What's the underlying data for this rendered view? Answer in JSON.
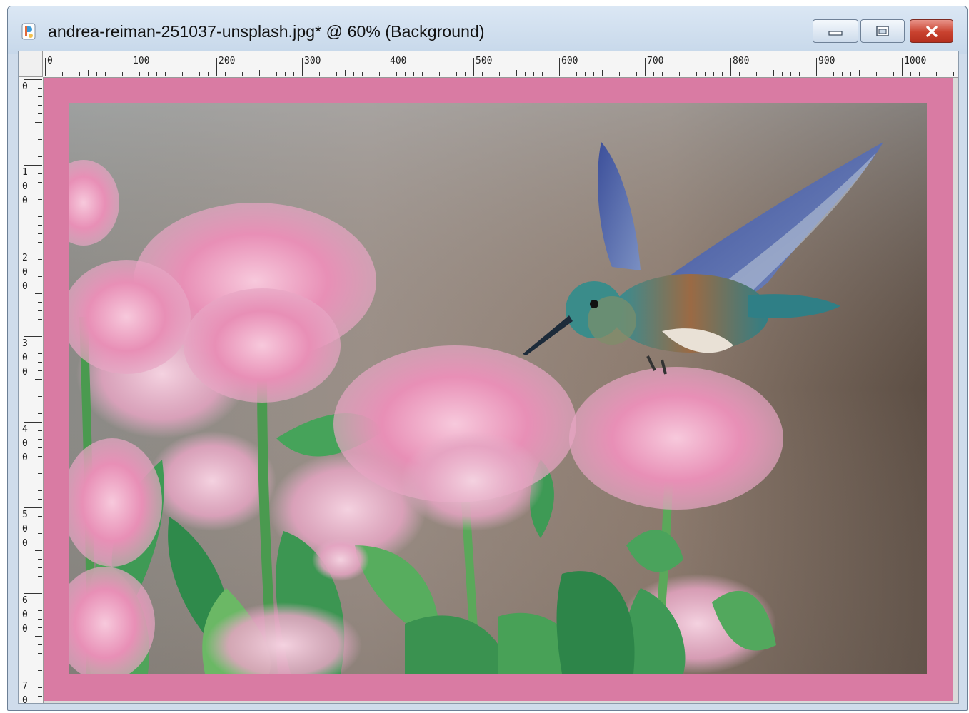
{
  "window": {
    "title": "andrea-reiman-251037-unsplash.jpg* @  60% (Background)",
    "controls": {
      "minimize_icon": "minimize-icon",
      "maximize_icon": "restore-icon",
      "close_icon": "close-icon"
    }
  },
  "rulers": {
    "horizontal": [
      "0",
      "100",
      "200",
      "300",
      "400",
      "500",
      "600",
      "700",
      "800",
      "900",
      "1000"
    ],
    "vertical": [
      [
        "0"
      ],
      [
        "1",
        "0",
        "0"
      ],
      [
        "2",
        "0",
        "0"
      ],
      [
        "3",
        "0",
        "0"
      ],
      [
        "4",
        "0",
        "0"
      ],
      [
        "5",
        "0",
        "0"
      ],
      [
        "6",
        "0",
        "0"
      ],
      [
        "7",
        "0"
      ]
    ]
  },
  "canvas": {
    "zoom": "60%",
    "layer": "Background",
    "frame_color": "#d97ba3"
  }
}
